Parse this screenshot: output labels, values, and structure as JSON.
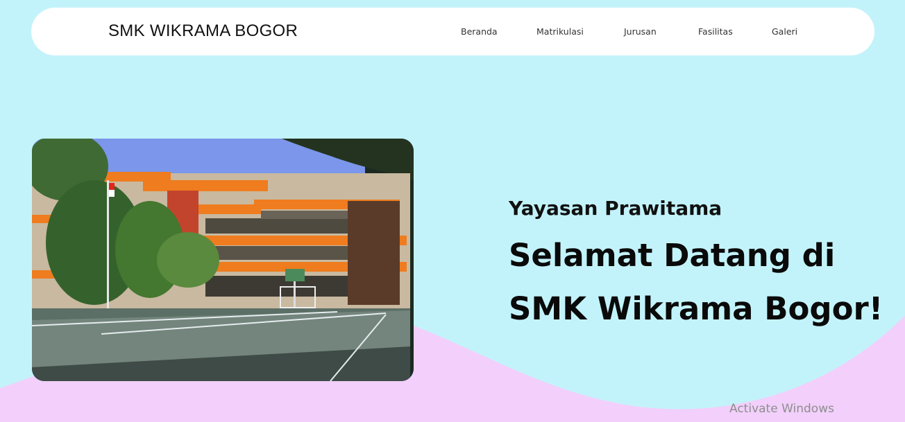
{
  "navbar": {
    "brand": "SMK WIKRAMA BOGOR",
    "links": [
      "Beranda",
      "Matrikulasi",
      "Jurusan",
      "Fasilitas",
      "Galeri"
    ]
  },
  "hero": {
    "subtitle": "Yayasan Prawitama",
    "title_line1": "Selamat Datang di",
    "title_line2": "SMK Wikrama Bogor!"
  },
  "watermark": "Activate Windows",
  "colors": {
    "background": "#c3f3fa",
    "wave": "#f2d0fb",
    "navbar": "#ffffff"
  }
}
